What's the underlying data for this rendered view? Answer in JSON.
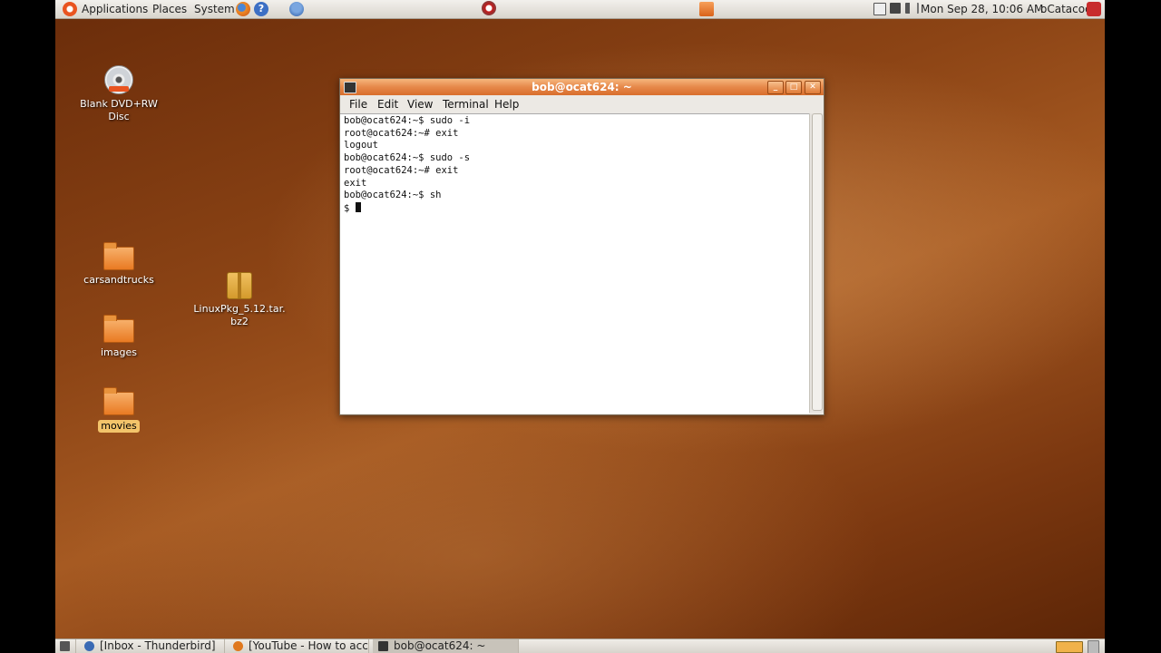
{
  "top_panel": {
    "menus": [
      "Applications",
      "Places",
      "System"
    ],
    "clock": "Mon Sep 28, 10:06 AM",
    "user": "oCatacoo"
  },
  "desktop": {
    "icons": [
      {
        "label": "Blank DVD+RW Disc",
        "badge": "DVD+RW"
      },
      {
        "label": "carsandtrucks"
      },
      {
        "label": "LinuxPkg_5.12.tar.bz2",
        "line1": "LinuxPkg_5.12.tar.",
        "line2": "bz2"
      },
      {
        "label": "images"
      },
      {
        "label": "movies"
      }
    ]
  },
  "terminal": {
    "title": "bob@ocat624: ~",
    "menu": [
      "File",
      "Edit",
      "View",
      "Terminal",
      "Help"
    ],
    "lines": [
      "bob@ocat624:~$ sudo -i",
      "root@ocat624:~# exit",
      "logout",
      "bob@ocat624:~$ sudo -s",
      "root@ocat624:~# exit",
      "exit",
      "bob@ocat624:~$ sh",
      "$ "
    ]
  },
  "taskbar": {
    "tasks": [
      "[Inbox - Thunderbird]",
      "[YouTube - How to acc...",
      "bob@ocat624: ~"
    ]
  },
  "colors": {
    "accent": "#e6884a",
    "wallpaper": "#8c4415"
  }
}
